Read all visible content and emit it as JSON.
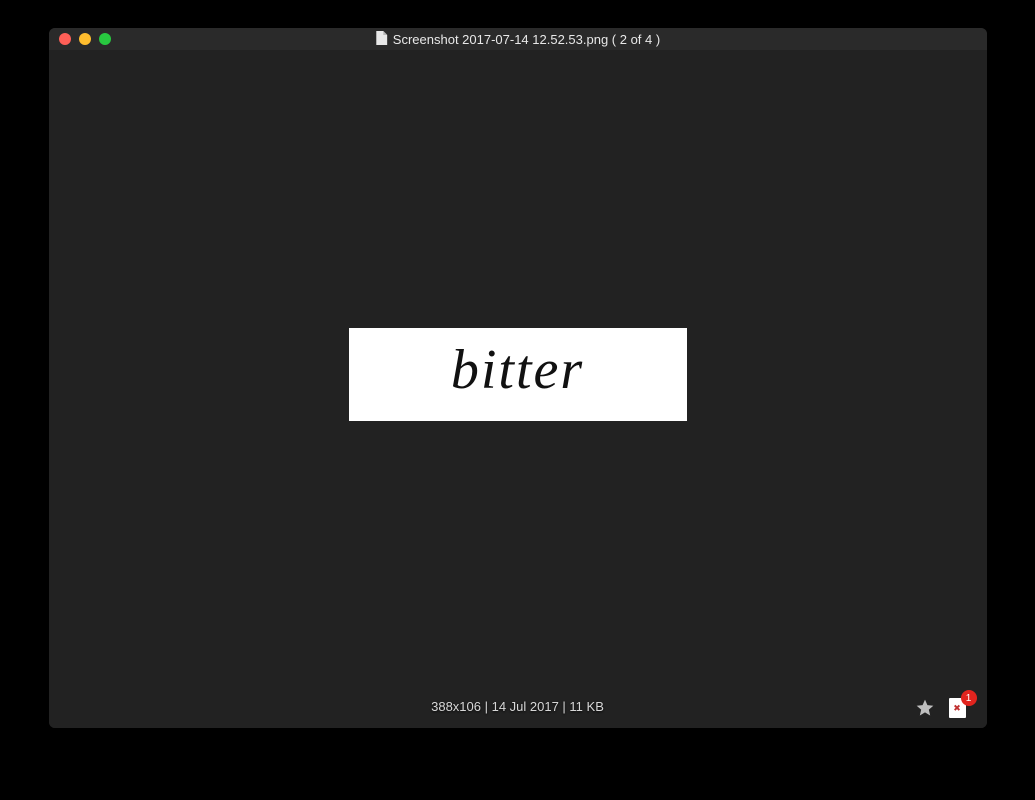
{
  "titlebar": {
    "filename": "Screenshot 2017-07-14 12.52.53.png ( 2 of 4 )"
  },
  "image": {
    "content_text": "bitter"
  },
  "info": {
    "status_text": "388x106 | 14 Jul 2017 | 11 KB"
  },
  "actions": {
    "badge_count": "1"
  }
}
